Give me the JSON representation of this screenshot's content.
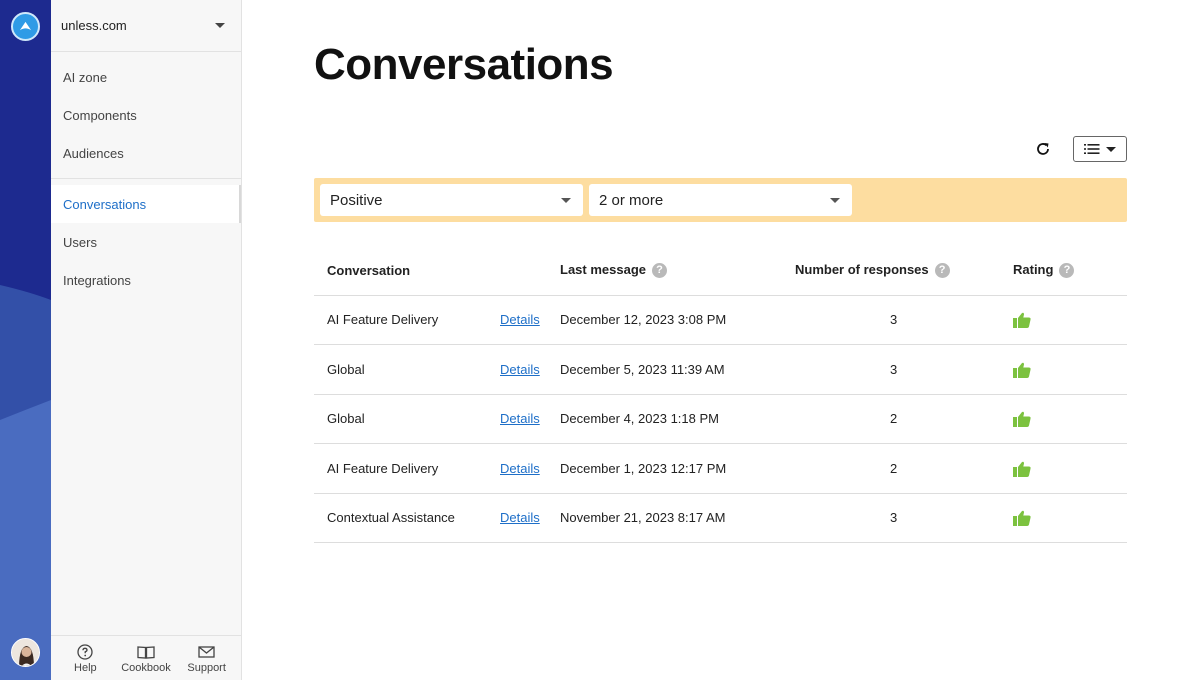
{
  "org": {
    "name": "unless.com"
  },
  "sidebar": {
    "groups": [
      [
        {
          "label": "AI zone"
        },
        {
          "label": "Components"
        },
        {
          "label": "Audiences"
        }
      ],
      [
        {
          "label": "Conversations"
        },
        {
          "label": "Users"
        },
        {
          "label": "Integrations"
        }
      ]
    ],
    "footer": [
      {
        "label": "Help"
      },
      {
        "label": "Cookbook"
      },
      {
        "label": "Support"
      }
    ]
  },
  "page": {
    "title": "Conversations"
  },
  "filters": {
    "sentiment": "Positive",
    "responses": "2 or more"
  },
  "table": {
    "headers": {
      "conversation": "Conversation",
      "last_message": "Last message",
      "responses": "Number of responses",
      "rating": "Rating"
    },
    "help_glyph": "?",
    "rows": [
      {
        "conversation": "AI Feature Delivery",
        "link": "Details",
        "last_message": "December 12, 2023 3:08 PM",
        "responses": "3"
      },
      {
        "conversation": "Global",
        "link": "Details",
        "last_message": "December 5, 2023 11:39 AM",
        "responses": "3"
      },
      {
        "conversation": "Global",
        "link": "Details",
        "last_message": "December 4, 2023 1:18 PM",
        "responses": "2"
      },
      {
        "conversation": "AI Feature Delivery",
        "link": "Details",
        "last_message": "December 1, 2023 12:17 PM",
        "responses": "2"
      },
      {
        "conversation": "Contextual Assistance",
        "link": "Details",
        "last_message": "November 21, 2023 8:17 AM",
        "responses": "3"
      }
    ]
  },
  "colors": {
    "accent": "#1e6fc8",
    "filter_bg": "#fddda0",
    "thumb": "#7cc23f",
    "rail": "#1d2a8f"
  },
  "icons": {
    "logo": "logo-icon",
    "refresh": "refresh-icon",
    "list_view": "list-view-icon",
    "thumb": "thumbs-up-icon"
  }
}
